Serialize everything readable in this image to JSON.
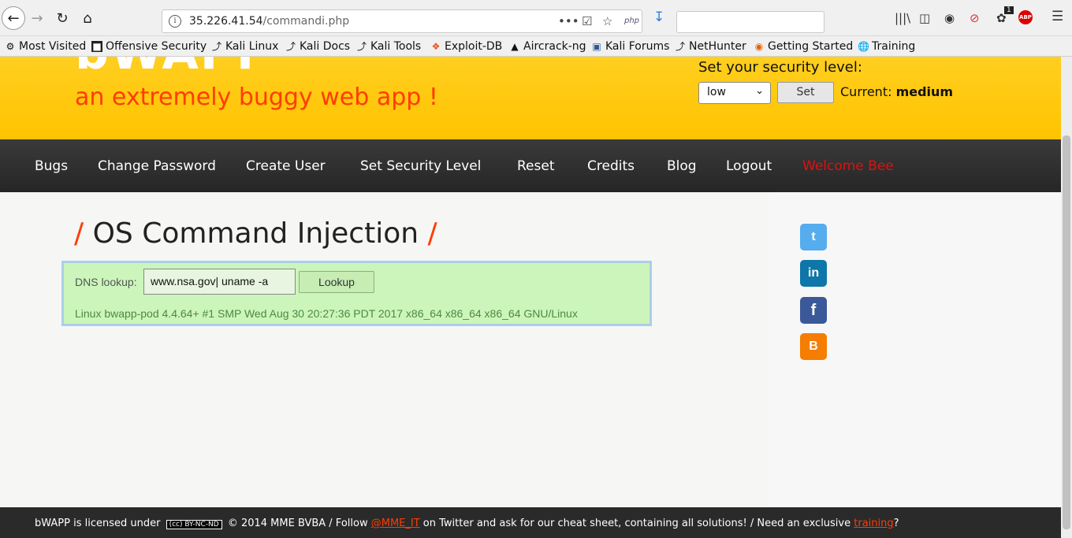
{
  "browser": {
    "url_host": "35.226.41.54",
    "url_path": "/commandi.php",
    "page_actions_label": "•••",
    "php_badge": "php",
    "notification_count": "1",
    "abp_label": "ABP",
    "icons": [
      "back-icon",
      "forward-icon",
      "reload-icon",
      "home-icon",
      "info-icon",
      "page-actions-icon",
      "pocket-icon",
      "bookmark-star-icon",
      "php-icon",
      "download-icon",
      "library-icon",
      "sidebar-icon",
      "extension-icon",
      "block-icon",
      "notification-icon",
      "adblock-icon",
      "menu-icon"
    ]
  },
  "bookmarks": [
    {
      "label": "Most Visited",
      "icon": "gear-icon"
    },
    {
      "label": "Offensive Security",
      "icon": "offsec-icon"
    },
    {
      "label": "Kali Linux",
      "icon": "kali-icon"
    },
    {
      "label": "Kali Docs",
      "icon": "kali-icon"
    },
    {
      "label": "Kali Tools",
      "icon": "kali-icon"
    },
    {
      "label": "Exploit-DB",
      "icon": "exploitdb-icon"
    },
    {
      "label": "Aircrack-ng",
      "icon": "aircrack-icon"
    },
    {
      "label": "Kali Forums",
      "icon": "forums-icon"
    },
    {
      "label": "NetHunter",
      "icon": "kali-icon"
    },
    {
      "label": "Getting Started",
      "icon": "firefox-icon"
    },
    {
      "label": "Training",
      "icon": "globe-icon"
    }
  ],
  "header": {
    "logo": "bWAPP",
    "tagline": "an extremely buggy web app !",
    "security_label": "Set your security level:",
    "security_selected": "low",
    "set_button": "Set",
    "current_label": "Current:",
    "current_value": "medium"
  },
  "menu": {
    "items": [
      "Bugs",
      "Change Password",
      "Create User",
      "Set Security Level",
      "Reset",
      "Credits",
      "Blog",
      "Logout"
    ],
    "welcome": "Welcome Bee"
  },
  "main": {
    "title_slash_left": "/",
    "title": "OS Command Injection",
    "title_slash_right": "/",
    "dns_label": "DNS lookup:",
    "dns_input_value": "www.nsa.gov| uname -a",
    "lookup_button": "Lookup",
    "output": "Linux bwapp-pod 4.4.64+ #1 SMP Wed Aug 30 20:27:36 PDT 2017 x86_64 x86_64 x86_64 GNU/Linux"
  },
  "social": [
    {
      "name": "twitter-icon",
      "glyph": "t",
      "color": "#55acee"
    },
    {
      "name": "linkedin-icon",
      "glyph": "in",
      "color": "#0e76a8"
    },
    {
      "name": "facebook-icon",
      "glyph": "f",
      "color": "#3b5998"
    },
    {
      "name": "blogger-icon",
      "glyph": "B",
      "color": "#f57d00"
    }
  ],
  "footer": {
    "text_1": "bWAPP is licensed under",
    "cc_badge": "(cc) BY-NC-ND",
    "text_2": "© 2014 MME BVBA / Follow",
    "twitter_link": "@MME_IT",
    "text_3": "on Twitter and ask for our cheat sheet, containing all solutions! / Need an exclusive",
    "training_link": "training",
    "text_4": "?"
  }
}
